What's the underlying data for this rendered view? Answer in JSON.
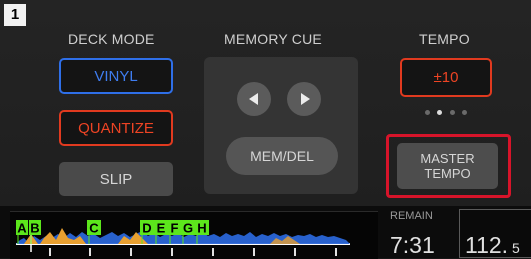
{
  "deck_number": "1",
  "sections": {
    "deck_mode": "DECK MODE",
    "memory_cue": "MEMORY CUE",
    "tempo": "TEMPO"
  },
  "deck_mode": {
    "vinyl": "VINYL",
    "quantize": "QUANTIZE",
    "slip": "SLIP"
  },
  "memory_cue": {
    "prev_icon": "triangle-left",
    "next_icon": "triangle-right",
    "mem_del": "MEM/DEL"
  },
  "tempo": {
    "range": "±10",
    "range_page_dots": 4,
    "range_page_active": 2,
    "master_tempo_line1": "MASTER",
    "master_tempo_line2": "TEMPO"
  },
  "status": {
    "remain_label": "REMAIN",
    "remain_time": "7:31",
    "bpm_int": "112.",
    "bpm_dec": "5"
  },
  "hot_cues": [
    "A",
    "B",
    "C",
    "D",
    "E",
    "F",
    "G",
    "H"
  ],
  "colors": {
    "vinyl_accent": "#2f6fe8",
    "quantize_accent": "#e13a1f",
    "tempo_accent": "#e13a1f",
    "highlight_frame": "#d7142a",
    "hot_cue": "#5ce61c",
    "wave_blue": "#2a66d8",
    "wave_orange": "#e8a030"
  }
}
